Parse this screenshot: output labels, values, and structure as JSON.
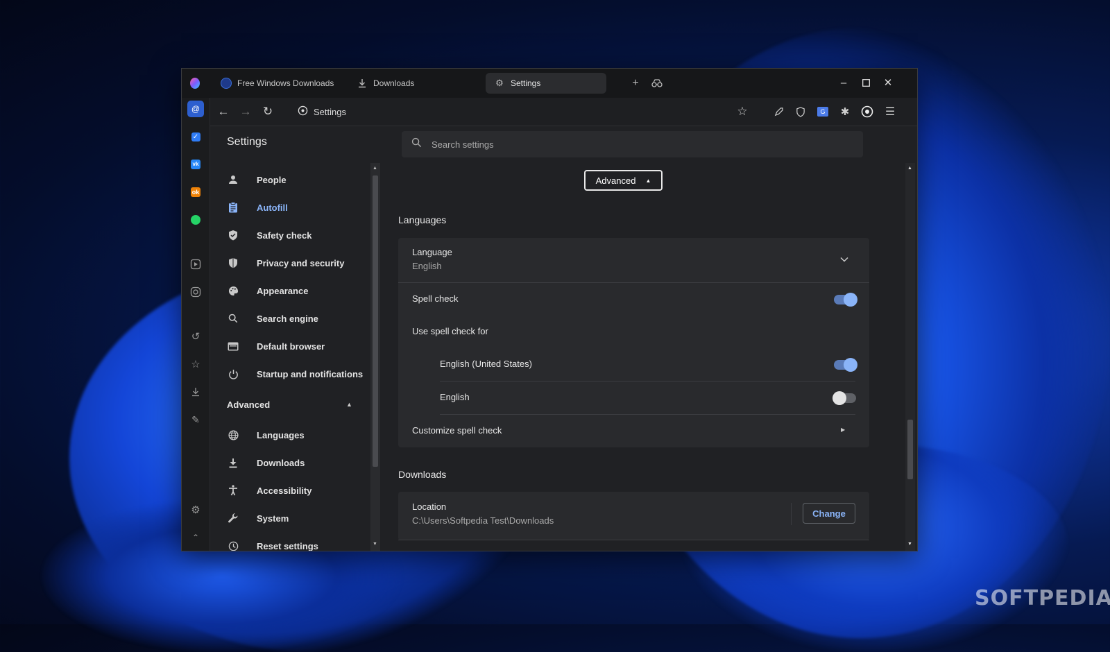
{
  "window": {
    "tabs": [
      {
        "label": "Free Windows Downloads",
        "icon": "globe-icon"
      },
      {
        "label": "Downloads",
        "icon": "download-icon"
      },
      {
        "label": "Settings",
        "icon": "gear-icon"
      }
    ]
  },
  "toolbar": {
    "address": "Settings"
  },
  "sidebar_apps": [
    "mail-icon",
    "tasks-icon",
    "vk-icon",
    "ok-icon",
    "whatsapp-icon",
    "player-icon",
    "instagram-icon",
    "history-icon",
    "bookmarks-icon",
    "downloads-icon",
    "extensions-icon",
    "settings-icon",
    "collapse-icon"
  ],
  "settings": {
    "title": "Settings",
    "search_placeholder": "Search settings",
    "nav": [
      {
        "label": "People",
        "icon": "person-icon"
      },
      {
        "label": "Autofill",
        "icon": "clipboard-icon",
        "active": true
      },
      {
        "label": "Safety check",
        "icon": "shield-check-icon"
      },
      {
        "label": "Privacy and security",
        "icon": "shield-icon"
      },
      {
        "label": "Appearance",
        "icon": "palette-icon"
      },
      {
        "label": "Search engine",
        "icon": "search-icon"
      },
      {
        "label": "Default browser",
        "icon": "browser-icon"
      },
      {
        "label": "Startup and notifications",
        "icon": "power-icon"
      }
    ],
    "advanced_label": "Advanced",
    "advanced_nav": [
      {
        "label": "Languages",
        "icon": "globe-icon"
      },
      {
        "label": "Downloads",
        "icon": "download-icon"
      },
      {
        "label": "Accessibility",
        "icon": "accessibility-icon"
      },
      {
        "label": "System",
        "icon": "wrench-icon"
      },
      {
        "label": "Reset settings",
        "icon": "reset-icon"
      }
    ]
  },
  "content": {
    "advanced_button": "Advanced",
    "languages": {
      "title": "Languages",
      "language_label": "Language",
      "language_value": "English",
      "spell_check_label": "Spell check",
      "spell_check_on": true,
      "use_spell_check_for": "Use spell check for",
      "spell_languages": [
        {
          "label": "English (United States)",
          "on": true
        },
        {
          "label": "English",
          "on": false
        }
      ],
      "customize_label": "Customize spell check"
    },
    "downloads": {
      "title": "Downloads",
      "location_label": "Location",
      "location_value": "C:\\Users\\Softpedia Test\\Downloads",
      "change_button": "Change"
    }
  },
  "watermark": "SOFTPEDIA",
  "colors": {
    "accent": "#8ab4f8",
    "background": "#202124",
    "card": "#292a2d"
  }
}
